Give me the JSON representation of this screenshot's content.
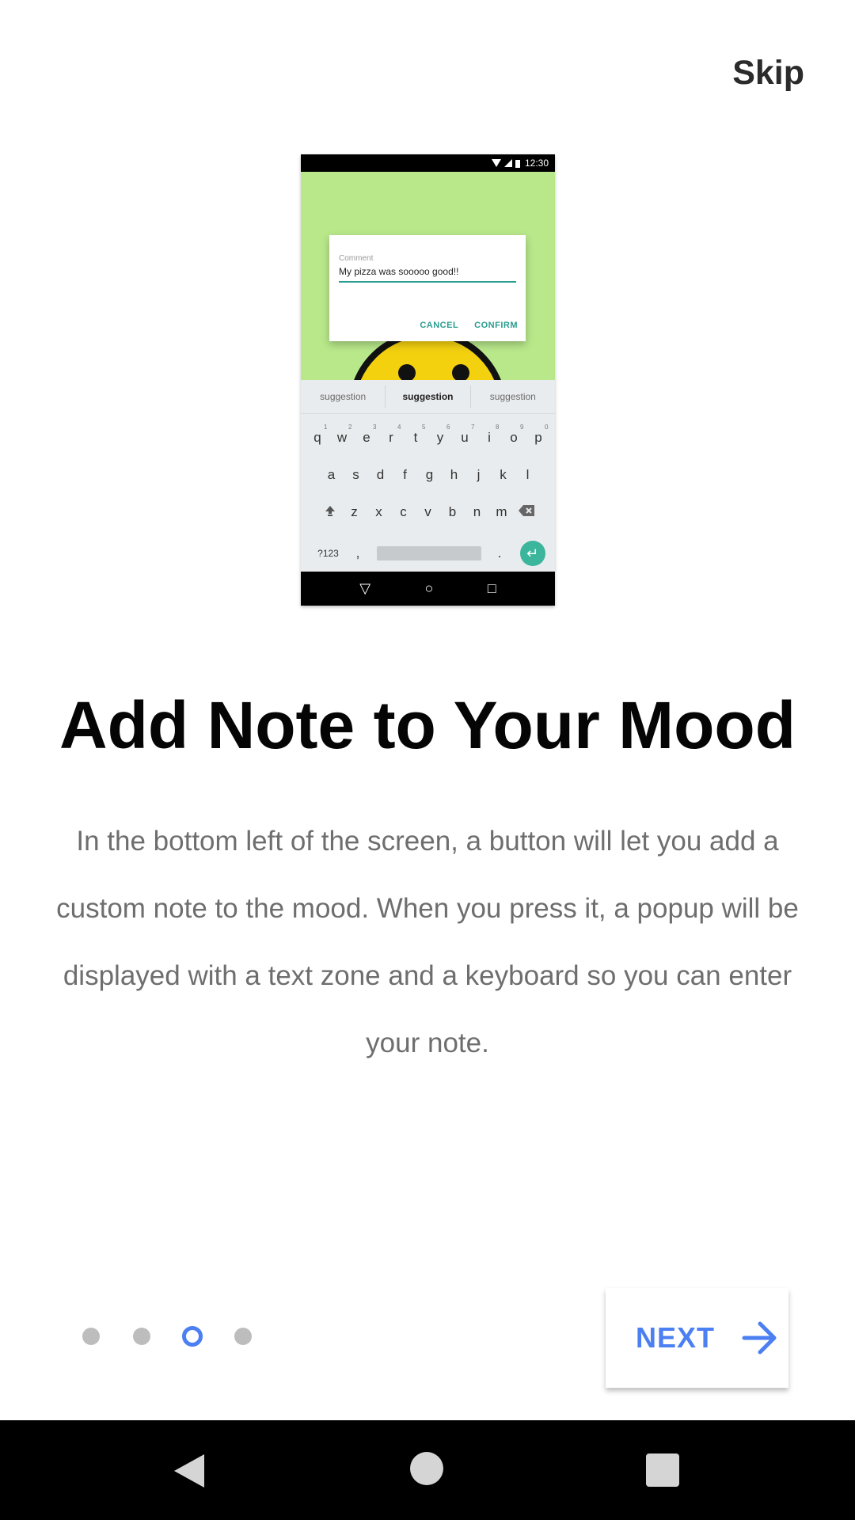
{
  "header": {
    "skip_label": "Skip"
  },
  "preview": {
    "status_time": "12:30",
    "dialog": {
      "label": "Comment",
      "input_value": "My pizza was sooooo good!!",
      "cancel_label": "CANCEL",
      "confirm_label": "CONFIRM"
    },
    "suggestions": [
      "suggestion",
      "suggestion",
      "suggestion"
    ],
    "keyboard": {
      "row1": [
        "q",
        "w",
        "e",
        "r",
        "t",
        "y",
        "u",
        "i",
        "o",
        "p"
      ],
      "row1_numbers": [
        "1",
        "2",
        "3",
        "4",
        "5",
        "6",
        "7",
        "8",
        "9",
        "0"
      ],
      "row2": [
        "a",
        "s",
        "d",
        "f",
        "g",
        "h",
        "j",
        "k",
        "l"
      ],
      "row3": [
        "z",
        "x",
        "c",
        "v",
        "b",
        "n",
        "m"
      ],
      "sym_label": "?123",
      "comma": ",",
      "period": "."
    }
  },
  "content": {
    "title": "Add Note to Your Mood",
    "description": "In the bottom left of the screen, a button will let you add a custom note to the mood. When you press it, a popup will be displayed with a text zone and a keyboard so you can enter your note."
  },
  "pager": {
    "total": 4,
    "current": 3
  },
  "footer": {
    "next_label": "NEXT"
  },
  "colors": {
    "accent": "#4b7ff2",
    "teal": "#2a9d8f",
    "phone_bg": "#b9e88b"
  }
}
